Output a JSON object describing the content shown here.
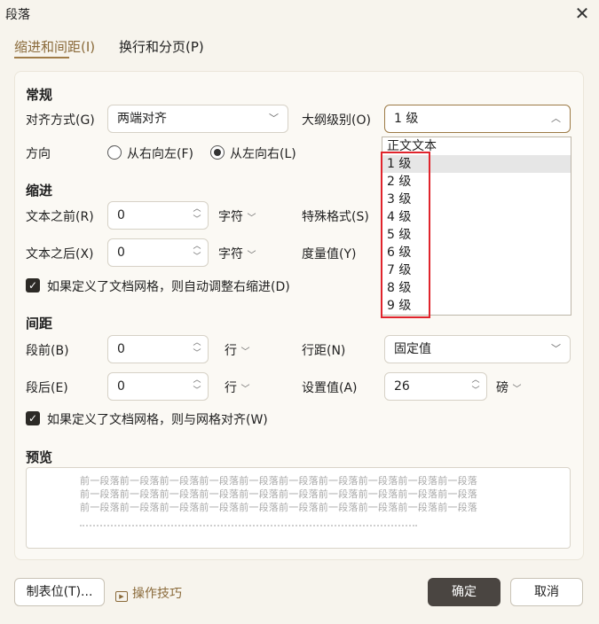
{
  "window": {
    "title": "段落"
  },
  "tabs": [
    {
      "label": "缩进和间距(I)"
    },
    {
      "label": "换行和分页(P)"
    }
  ],
  "general": {
    "title": "常规",
    "align_label": "对齐方式(G)",
    "align_value": "两端对齐",
    "outline_label": "大纲级别(O)",
    "outline_value": "1 级",
    "direction_label": "方向",
    "rtl_label": "从右向左(F)",
    "ltr_label": "从左向右(L)"
  },
  "outline_options": [
    "正文文本",
    "1 级",
    "2 级",
    "3 级",
    "4 级",
    "5 级",
    "6 级",
    "7 级",
    "8 级",
    "9 级"
  ],
  "indent": {
    "title": "缩进",
    "before_label": "文本之前(R)",
    "before_value": "0",
    "before_unit": "字符",
    "after_label": "文本之后(X)",
    "after_value": "0",
    "after_unit": "字符",
    "special_label": "特殊格式(S)",
    "measure_label": "度量值(Y)",
    "auto_adjust_label": "如果定义了文档网格，则自动调整右缩进(D)"
  },
  "spacing": {
    "title": "间距",
    "before_label": "段前(B)",
    "before_value": "0",
    "before_unit": "行",
    "after_label": "段后(E)",
    "after_value": "0",
    "after_unit": "行",
    "line_label": "行距(N)",
    "line_value": "固定值",
    "set_label": "设置值(A)",
    "set_value": "26",
    "set_unit": "磅",
    "grid_label": "如果定义了文档网格，则与网格对齐(W)"
  },
  "preview": {
    "title": "预览",
    "line1": "前一段落前一段落前一段落前一段落前一段落前一段落前一段落前一段落前一段落前一段落",
    "line2": "前一段落前一段落前一段落前一段落前一段落前一段落前一段落前一段落前一段落前一段落",
    "line3": "前一段落前一段落前一段落前一段落前一段落前一段落前一段落前一段落前一段落前一段落"
  },
  "footer": {
    "tabs_label": "制表位(T)...",
    "tips_label": "操作技巧",
    "ok_label": "确定",
    "cancel_label": "取消"
  }
}
